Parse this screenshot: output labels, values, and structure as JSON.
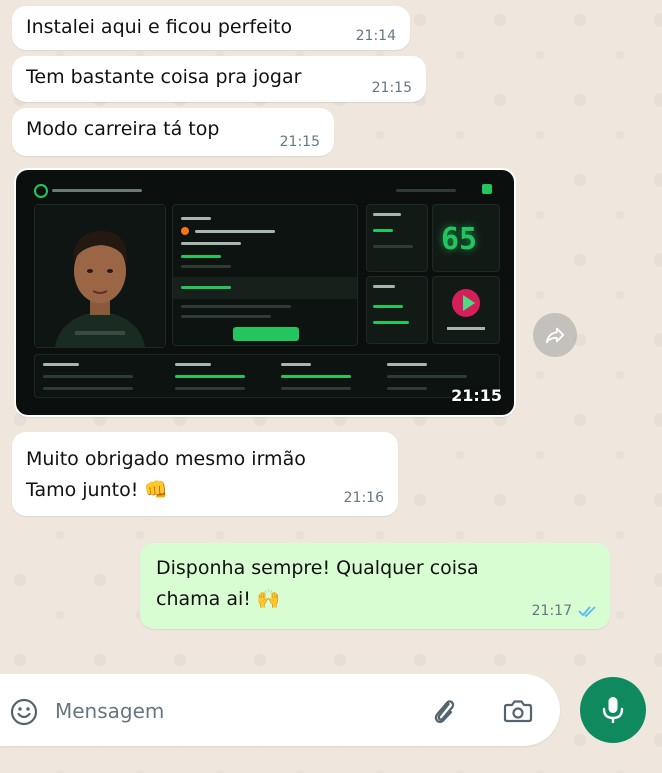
{
  "messages": [
    {
      "text": "Instalei aqui e ficou perfeito",
      "time": "21:14",
      "direction": "incoming"
    },
    {
      "text": "Tem bastante coisa pra jogar",
      "time": "21:15",
      "direction": "incoming"
    },
    {
      "text": "Modo carreira tá top",
      "time": "21:15",
      "direction": "incoming"
    },
    {
      "type": "image",
      "time": "21:15",
      "direction": "incoming",
      "content": "game-screenshot"
    },
    {
      "text": "Muito obrigado mesmo irmão\nTamo junto! 👊",
      "time": "21:16",
      "direction": "incoming"
    },
    {
      "text": "Disponha sempre! Qualquer coisa\nchama ai! 🙌",
      "time": "21:17",
      "direction": "outgoing",
      "status": "read"
    }
  ],
  "game_screen": {
    "big_number": "65"
  },
  "input": {
    "placeholder": "Mensagem"
  },
  "colors": {
    "incoming_bubble": "#ffffff",
    "outgoing_bubble": "#d9fdd3",
    "mic_button": "#0f8a5f",
    "read_ticks": "#53bdeb",
    "wallpaper": "#efe7de"
  }
}
